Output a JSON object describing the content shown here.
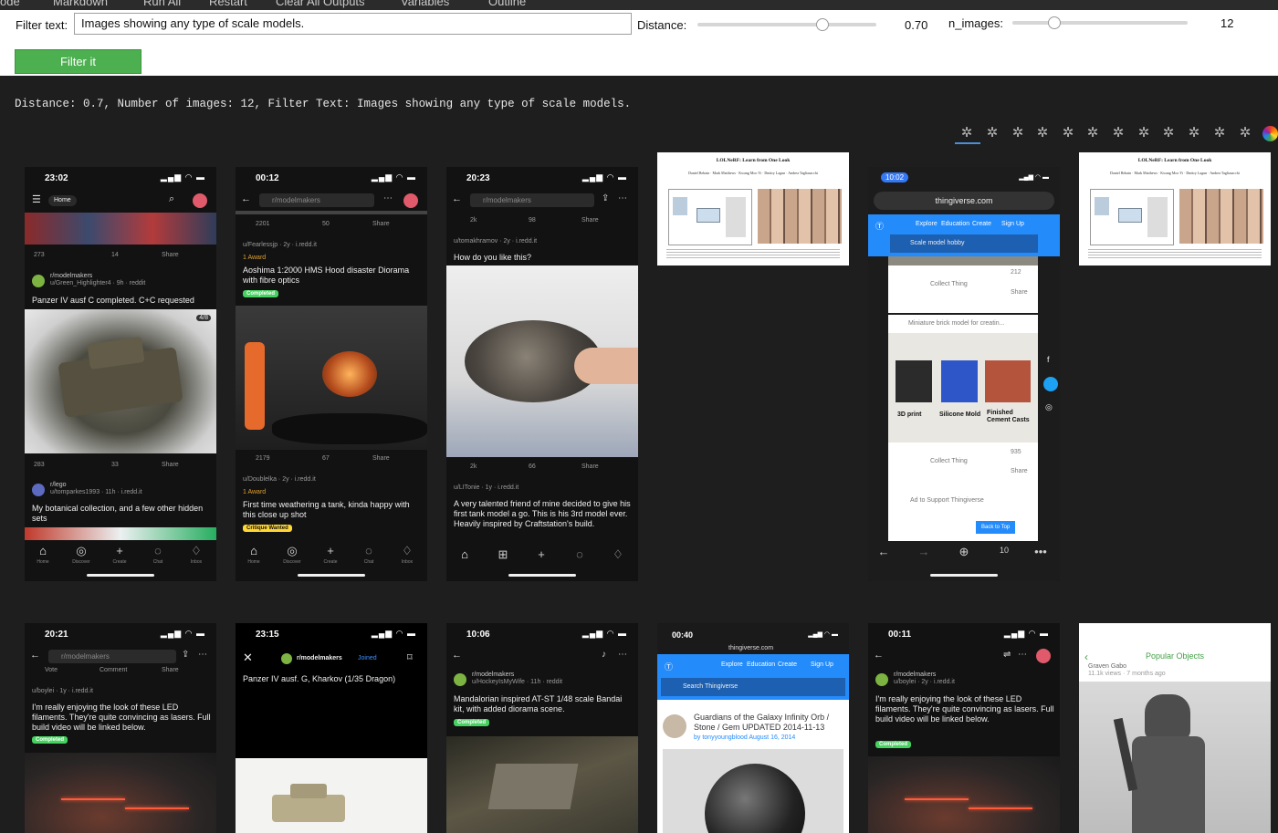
{
  "toolbar": {
    "items": [
      "ode",
      "Markdown",
      "Run All",
      "Restart",
      "Clear All Outputs",
      "Variables",
      "Outline"
    ]
  },
  "widgets": {
    "filter_label": "Filter text:",
    "filter_value": "Images showing any type of scale models.",
    "distance_label": "Distance:",
    "distance_value": "0.70",
    "distance_level": 0.7,
    "n_images_label": "n_images:",
    "n_images_value": "12",
    "n_images_level": 0.24,
    "button_label": "Filter it"
  },
  "status_line": "Distance: 0.7, Number of images: 12, Filter Text: Images showing any type of scale models.",
  "spinner_icon": "loading-spinner-icon",
  "colors": {
    "button": "#4caf50",
    "reddit_orange": "#ff4500",
    "thingiverse_blue": "#248bfb",
    "completed_tag": "#46d160",
    "critique_tag": "#ffd635"
  },
  "cards": {
    "c1": {
      "time": "23:02",
      "nav_title": "Home",
      "votes": "273",
      "comments": "14",
      "share": "Share",
      "sub": "r/modelmakers",
      "user": "u/Green_Highlighter4 · 9h · reddit",
      "title": "Panzer IV ausf C completed. C+C requested",
      "pager": "4/8",
      "votes2": "283",
      "comments2": "33",
      "sub2": "r/lego",
      "user2": "u/tomparkes1993 · 11h · i.redd.it",
      "title2": "My botanical collection, and a few other hidden sets",
      "nav": [
        "Home",
        "Discover",
        "Create",
        "Chat",
        "Inbox"
      ]
    },
    "c2": {
      "time": "00:12",
      "search": "r/modelmakers",
      "votes": "2201",
      "comments": "50",
      "share": "Share",
      "user": "u/Fearlessjp · 2y · i.redd.it",
      "award": "1 Award",
      "title": "Aoshima 1:2000 HMS Hood disaster Diorama with fibre optics",
      "tag": "Completed",
      "votes2": "2179",
      "comments2": "67",
      "user2": "u/Doublelka · 2y · i.redd.it",
      "award2": "1 Award",
      "title2": "First time weathering a tank, kinda happy with this close up shot",
      "tag2": "Critique Wanted",
      "nav": [
        "Home",
        "Discover",
        "Create",
        "Chat",
        "Inbox"
      ]
    },
    "c3": {
      "time": "20:23",
      "search": "r/modelmakers",
      "votes": "2k",
      "comments": "98",
      "share": "Share",
      "user": "u/tomakhramov · 2y · i.redd.it",
      "title": "How do you like this?",
      "votes2": "2k",
      "comments2": "66",
      "user2": "u/LITonie · 1y · i.redd.it",
      "title2": "A very talented friend of mine decided to give his first tank model a go. This is his 3rd model ever. Heavily inspired by Craftstation's build."
    },
    "c4": {
      "paper_title": "LOLNeRF: Learn from One Look",
      "paper_authors": "Daniel Rebain · Mark Matthews · Kwang Moo Yi · Dmitry Lagun · Andrea Tagliasacchi"
    },
    "c5": {
      "time": "10:02",
      "url": "thingiverse.com",
      "nav_links": [
        "Explore",
        "Education",
        "Create",
        "Sign Up"
      ],
      "search": "Scale model hobby",
      "likes": "212",
      "share": "Share",
      "collect": "Collect Thing",
      "item_title": "Miniature brick model for creatin...",
      "labels": [
        "3D print",
        "Silicone Mold",
        "Finished Cement Casts"
      ],
      "likes2": "935",
      "ad": "Ad to Support Thingiverse",
      "back": "Back to Top",
      "tabs": "10"
    },
    "c6": {
      "paper_title": "LOLNeRF: Learn from One Look",
      "paper_authors": "Daniel Rebain · Mark Matthews · Kwang Moo Yi · Dmitry Lagun · Andrea Tagliasacchi"
    },
    "c7": {
      "time": "20:21",
      "search": "r/modelmakers",
      "vote": "Vote",
      "comment": "Comment",
      "share": "Share",
      "user": "u/boylei · 1y · i.redd.it",
      "title": "I'm really enjoying the look of these LED filaments. They're quite convincing as lasers. Full build video will be linked below.",
      "tag": "Completed"
    },
    "c8": {
      "time": "23:15",
      "sub": "r/modelmakers",
      "joined": "Joined",
      "title": "Panzer IV ausf. G, Kharkov (1/35 Dragon)"
    },
    "c9": {
      "time": "10:06",
      "sub": "r/modelmakers",
      "user": "u/HockeyIsMyWife · 11h · reddit",
      "title": "Mandalorian inspired AT-ST 1/48 scale Bandai kit, with added diorama scene.",
      "tag": "Completed"
    },
    "c10": {
      "time": "00:40",
      "url": "thingiverse.com",
      "nav_links": [
        "Explore",
        "Education",
        "Create",
        "Sign Up"
      ],
      "search": "Search Thingiverse",
      "title": "Guardians of the Galaxy Infinity Orb / Stone / Gem UPDATED 2014-11-13",
      "byline": "by tonyyoungblood  August 16, 2014"
    },
    "c11": {
      "time": "00:11",
      "sub": "r/modelmakers",
      "user": "u/boylei · 2y · i.redd.it",
      "title": "I'm really enjoying the look of these LED filaments. They're quite convincing as lasers. Full build video will be linked below.",
      "tag": "Completed"
    },
    "c12": {
      "header": "Popular Objects",
      "sub": "Graven Gabo",
      "meta": "11.1k views · 7 months ago"
    }
  }
}
